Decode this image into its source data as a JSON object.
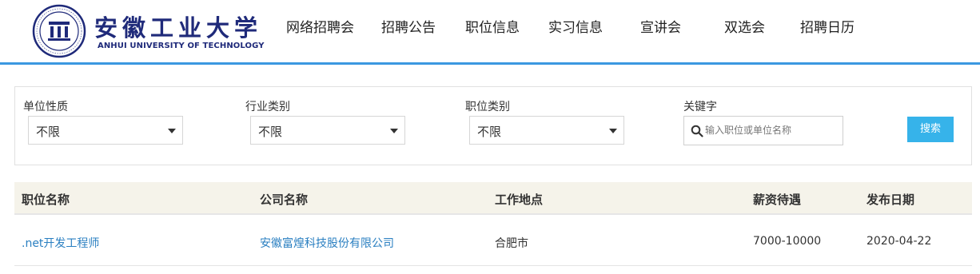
{
  "header": {
    "logo_cn": "安徽工业大学",
    "logo_en": "ANHUI UNIVERSITY OF TECHNOLOGY",
    "nav": [
      "网络招聘会",
      "招聘公告",
      "职位信息",
      "实习信息",
      "宣讲会",
      "双选会",
      "招聘日历"
    ]
  },
  "filters": {
    "unit_type": {
      "label": "单位性质",
      "value": "不限"
    },
    "industry": {
      "label": "行业类别",
      "value": "不限"
    },
    "job_category": {
      "label": "职位类别",
      "value": "不限"
    },
    "keyword": {
      "label": "关键字",
      "placeholder": "输入职位或单位名称",
      "value": ""
    },
    "search_label": "搜索"
  },
  "table": {
    "headers": [
      "职位名称",
      "公司名称",
      "工作地点",
      "薪资待遇",
      "发布日期"
    ],
    "rows": [
      {
        "position": ".net开发工程师",
        "company": "安徽富煌科技股份有限公司",
        "location": "合肥市",
        "salary": "7000-10000",
        "date": "2020-04-22"
      }
    ]
  },
  "colors": {
    "accent_line": "#3b98e0",
    "search_button": "#36b3ea",
    "link": "#2a7fc1",
    "table_header_bg": "#f5f3ea",
    "logo": "#1f2a7a"
  }
}
